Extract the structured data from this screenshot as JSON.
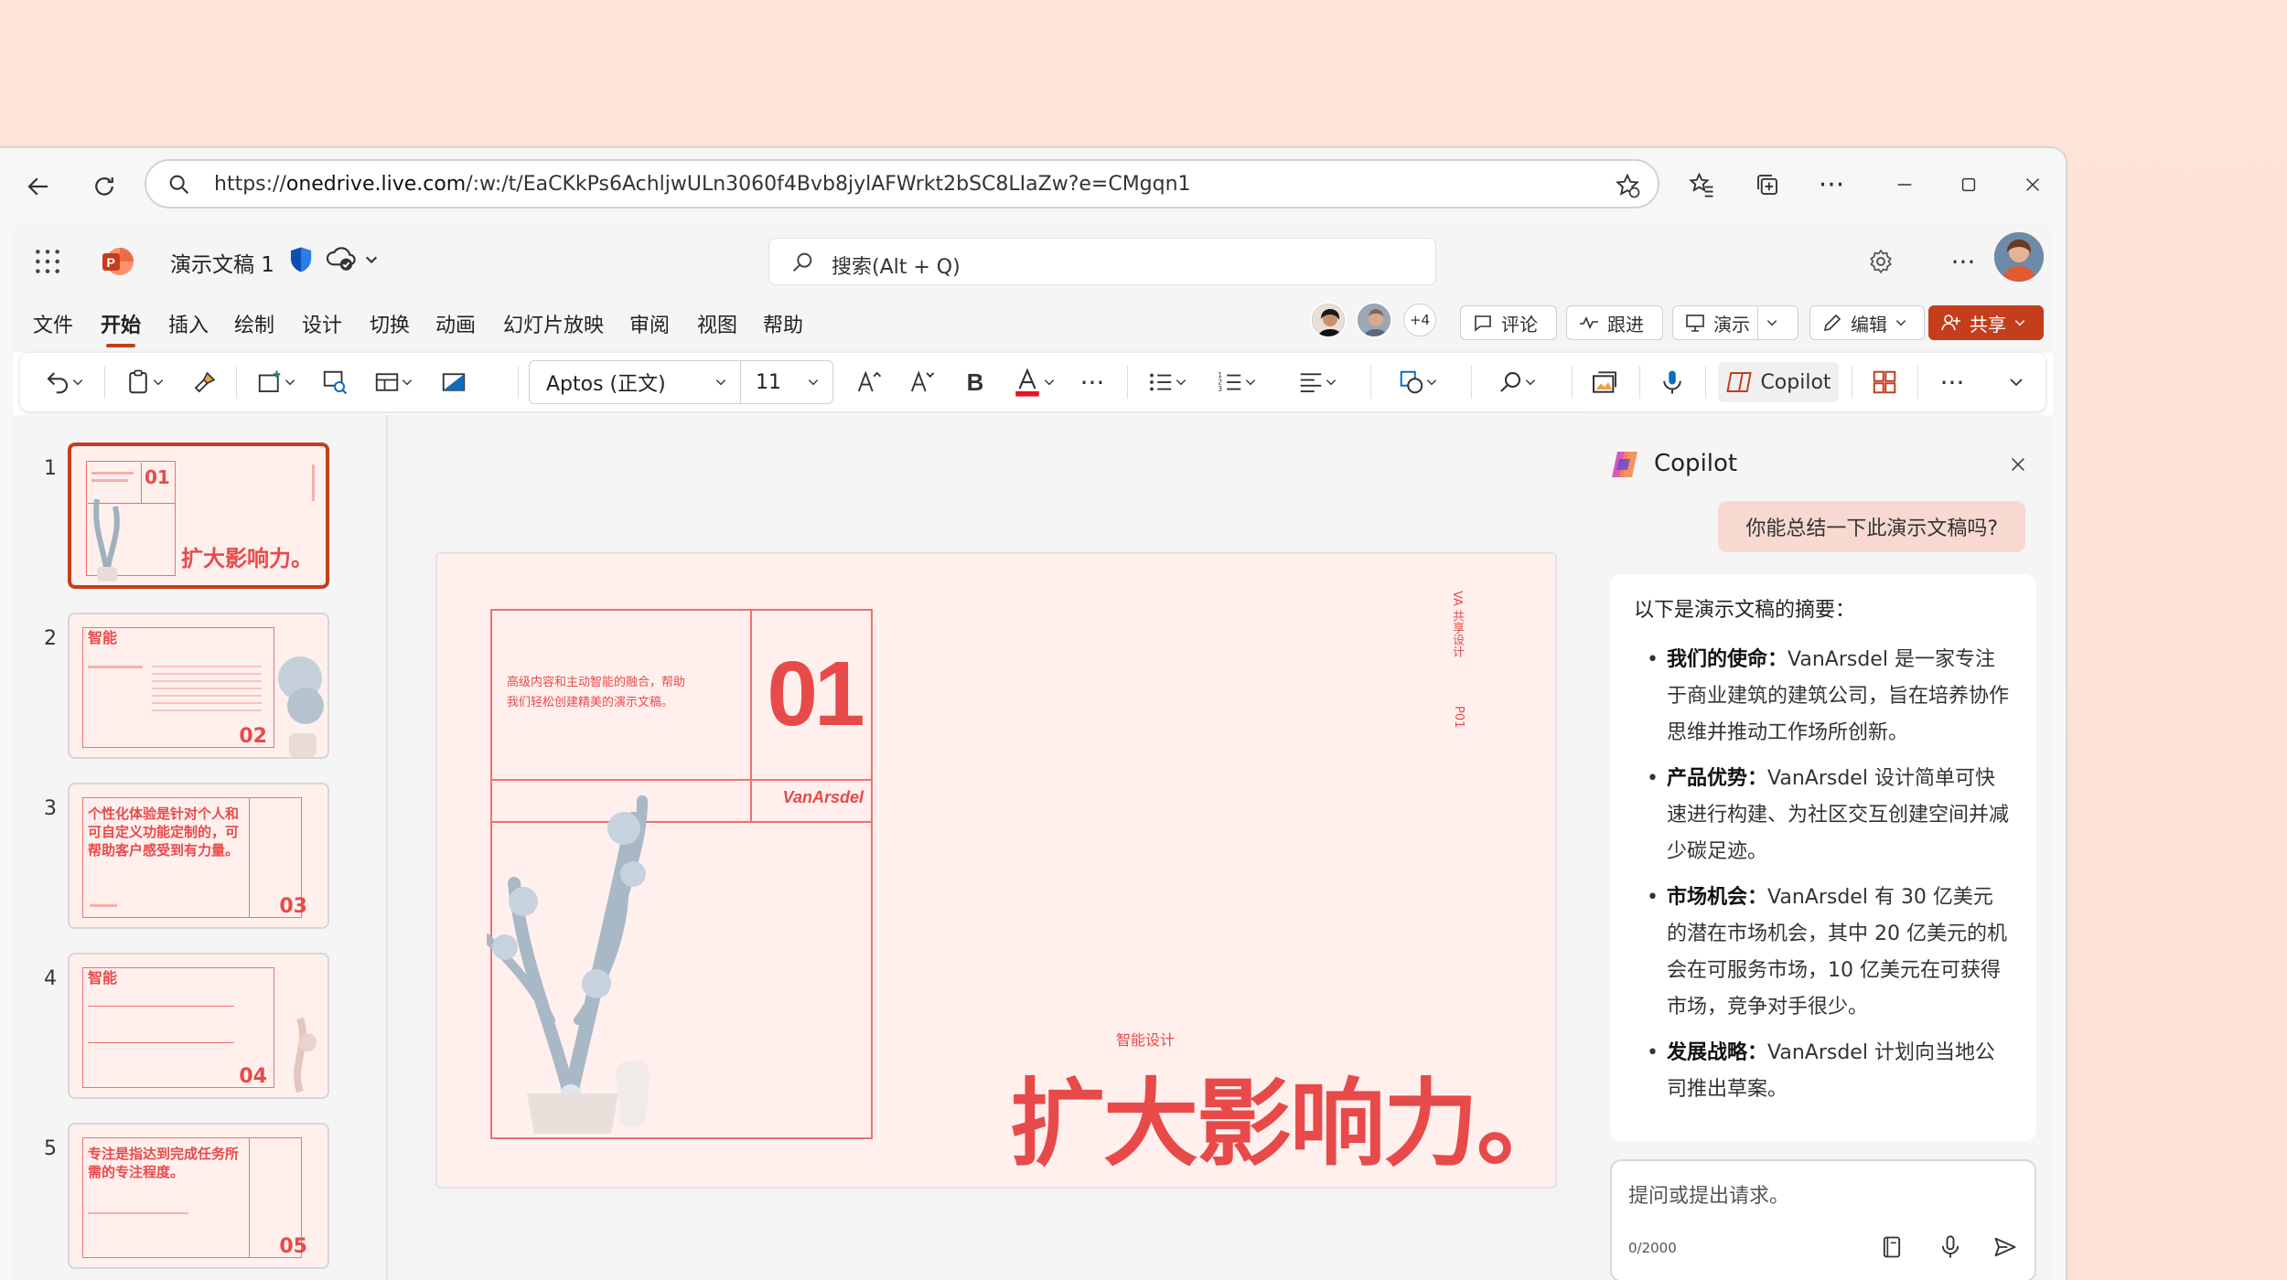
{
  "browser": {
    "url_prefix": "https://",
    "url_domain": "onedrive.live.com",
    "url_rest": "/:w:/t/EaCKkPs6AchljwULn3060f4Bvb8jylAFWrkt2bSC8LIaZw?e=CMgqn1"
  },
  "app": {
    "doc_title": "演示文稿 1",
    "search_placeholder": "搜索(Alt + Q)",
    "tabs": [
      "文件",
      "开始",
      "插入",
      "绘制",
      "设计",
      "切换",
      "动画",
      "幻灯片放映",
      "审阅",
      "视图",
      "帮助"
    ],
    "active_tab": "开始",
    "collaborators_extra": "+4",
    "comment_label": "评论",
    "follow_label": "跟进",
    "present_label": "演示",
    "edit_label": "编辑",
    "share_label": "共享"
  },
  "toolbar": {
    "font_name": "Aptos (正文)",
    "font_size": "11",
    "copilot_label": "Copilot"
  },
  "thumbnails": [
    {
      "index": "1",
      "num": "01",
      "title": "扩大影响力。"
    },
    {
      "index": "2",
      "num": "02",
      "title": "智能"
    },
    {
      "index": "3",
      "num": "03",
      "title": "个性化体验是针对个人和可自定义功能定制的，可帮助客户感受到有力量。"
    },
    {
      "index": "4",
      "num": "04",
      "title": "智能"
    },
    {
      "index": "5",
      "num": "05",
      "title": "专注是指达到完成任务所需的专注程度。"
    }
  ],
  "slide": {
    "intro_text": "高级内容和主动智能的融合，帮助我们轻松创建精美的演示文稿。",
    "number": "01",
    "brand": "VanArsdel",
    "side_label": "VA 共享设计",
    "side_page": "P01",
    "subtitle": "智能设计",
    "headline": "扩大影响力。"
  },
  "copilot": {
    "title": "Copilot",
    "user_message": "你能总结一下此演示文稿吗?",
    "answer_intro": "以下是演示文稿的摘要：",
    "points": [
      {
        "label": "我们的使命：",
        "text": "VanArsdel 是一家专注于商业建筑的建筑公司，旨在培养协作思维并推动工作场所创新。"
      },
      {
        "label": "产品优势：",
        "text": "VanArsdel 设计简单可快速进行构建、为社区交互创建空间并减少碳足迹。"
      },
      {
        "label": "市场机会：",
        "text": "VanArsdel 有 30 亿美元的潜在市场机会，其中 20 亿美元的机会在可服务市场，10 亿美元在可获得市场，竞争对手很少。"
      },
      {
        "label": "发展战略：",
        "text": "VanArsdel 计划向当地公司推出草案。"
      }
    ],
    "input_placeholder": "提问或提出请求。",
    "char_count": "0/2000"
  },
  "colors": {
    "accent": "#c43e1c",
    "slide_red": "#e84a4a",
    "page_bg": "#fde3d9"
  }
}
